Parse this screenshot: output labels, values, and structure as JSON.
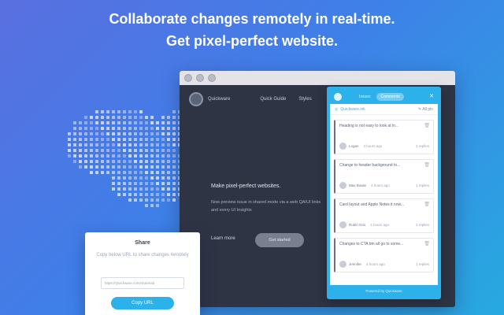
{
  "headline": {
    "line1": "Collaborate changes remotely in real-time.",
    "line2": "Get pixel-perfect website."
  },
  "site": {
    "name": "Quickware",
    "nav": [
      "Quick Guide",
      "Styles"
    ],
    "hero_title": "Make pixel-perfect websites.",
    "hero_text": "Now preview issue in shared mode via a web QA/UI links and every UI Insights",
    "learn_more": "Learn more",
    "get_started": "Get started"
  },
  "panel": {
    "tabs": [
      "Issues",
      "Comments"
    ],
    "active_tab": "Comments",
    "url_label": "Quickware.ink",
    "filter_label": "All pin",
    "comments": [
      {
        "text": "Heading is not easy to look at in...",
        "user": "Logan",
        "time": "4 hours ago",
        "replies": "2 replies"
      },
      {
        "text": "Change to header background to...",
        "user": "Max Bowie",
        "time": "4 hours ago",
        "replies": "1 replies"
      },
      {
        "text": "Card layout and Apple Notes it now...",
        "user": "Robin Grix",
        "time": "4 hours ago",
        "replies": "2 replies"
      },
      {
        "text": "Changes to CTA btn all go to some...",
        "user": "Jennifer",
        "time": "4 hours ago",
        "replies": "1 replies"
      }
    ],
    "footer": "Powered by Quickware"
  },
  "share": {
    "title": "Share",
    "description": "Copy below URL to share changes remotely",
    "url_value": "https://Quickware.com/share/ab",
    "button": "Copy URL"
  },
  "colors": {
    "accent": "#2db1ea",
    "site_bg": "#2f3445",
    "bg_start": "#5a6fe0",
    "bg_end": "#27a9e0"
  }
}
